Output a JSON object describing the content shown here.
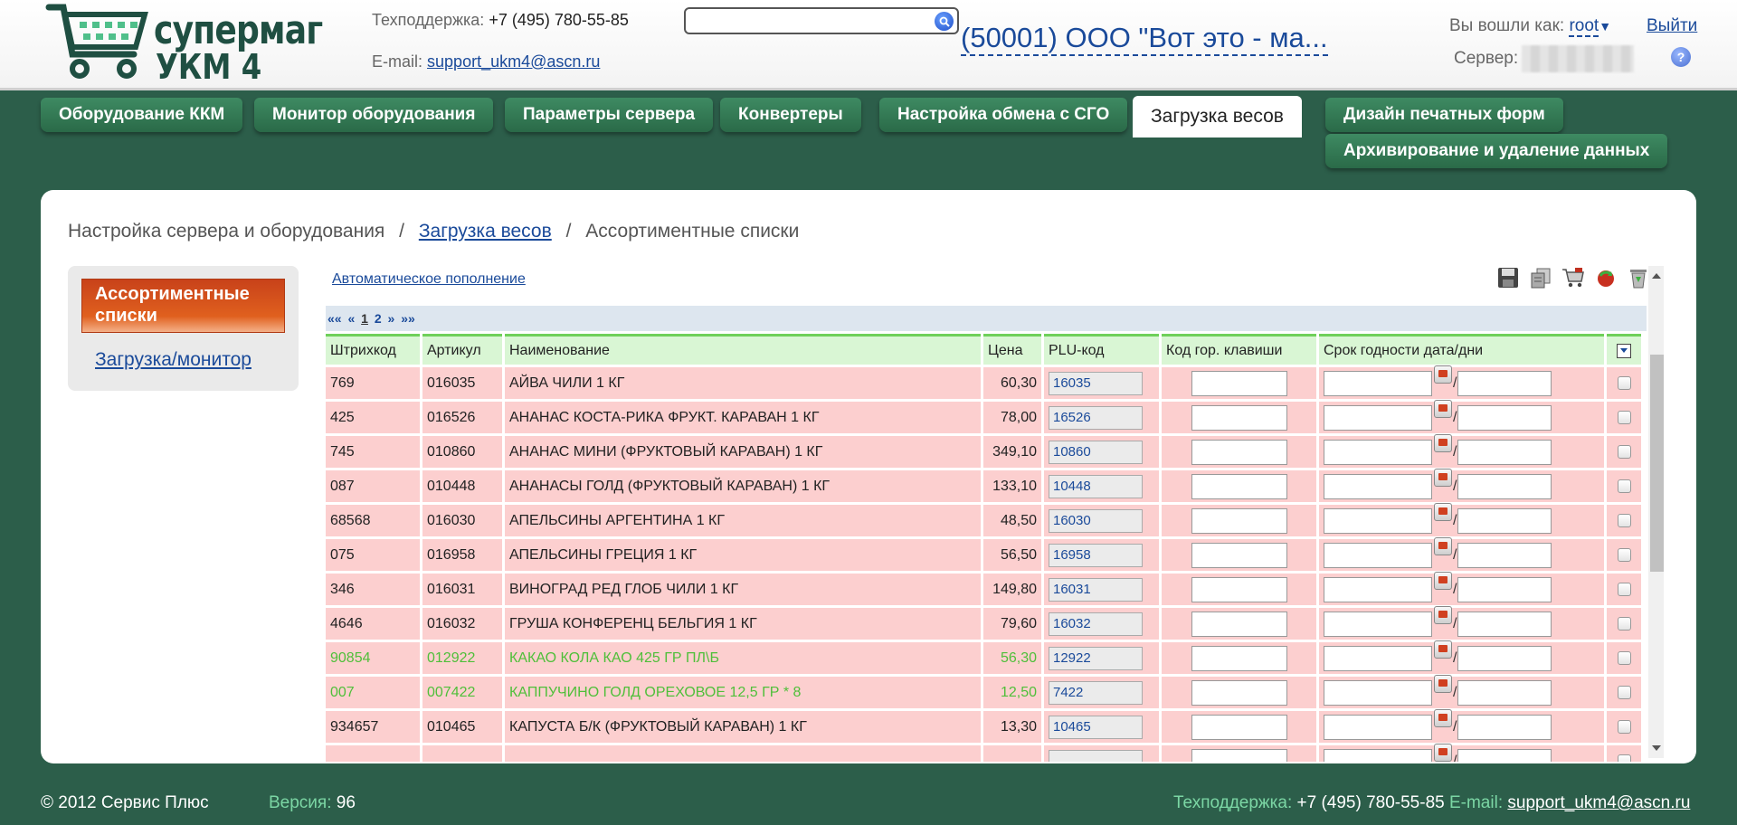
{
  "header": {
    "logo_line1": "супермаг",
    "logo_line2": "УКМ 4",
    "support_phone_label": "Техподдержка:",
    "support_phone": "+7 (495) 780-55-85",
    "email_label": "E-mail:",
    "email": "support_ukm4@ascn.ru",
    "search_value": "",
    "org_name": "(50001) ООО \"Вот это - ма...",
    "login_label": "Вы вошли как:",
    "login_user": "root",
    "logout": "Выйти",
    "server_label": "Сервер:"
  },
  "tabs": [
    {
      "label": "Оборудование ККМ"
    },
    {
      "label": "Монитор оборудования"
    },
    {
      "label": "Параметры сервера"
    },
    {
      "label": "Конвертеры"
    },
    {
      "label": "Настройка обмена с СГО"
    },
    {
      "label": "Загрузка весов"
    },
    {
      "label": "Дизайн печатных форм"
    },
    {
      "label": "Архивирование и удаление данных"
    }
  ],
  "active_tab": "Загрузка весов",
  "breadcrumb": {
    "root": "Настройка сервера и оборудования",
    "section": "Загрузка весов",
    "current": "Ассортиментные списки"
  },
  "sidebar": {
    "active": "Ассортиментные списки",
    "link": "Загрузка/монитор"
  },
  "content": {
    "auto_fill": "Автоматическое пополнение",
    "pager": {
      "first": "««",
      "prev": "«",
      "pages": [
        "1",
        "2"
      ],
      "current": "1",
      "next": "»",
      "last": "»»"
    },
    "columns": [
      "Штрихкод",
      "Артикул",
      "Наименование",
      "Цена",
      "PLU-код",
      "Код гор. клавиши",
      "Срок годности дата/дни"
    ],
    "rows": [
      {
        "barcode": "769",
        "article": "016035",
        "name": "АЙВА ЧИЛИ 1 КГ",
        "price": "60,30",
        "plu": "16035",
        "green": false
      },
      {
        "barcode": "425",
        "article": "016526",
        "name": "АНАНАС КОСТА-РИКА ФРУКТ. КАРАВАН 1 КГ",
        "price": "78,00",
        "plu": "16526",
        "green": false
      },
      {
        "barcode": "745",
        "article": "010860",
        "name": "АНАНАС МИНИ (ФРУКТОВЫЙ КАРАВАН) 1 КГ",
        "price": "349,10",
        "plu": "10860",
        "green": false
      },
      {
        "barcode": "087",
        "article": "010448",
        "name": "АНАНАСЫ ГОЛД (ФРУКТОВЫЙ КАРАВАН) 1 КГ",
        "price": "133,10",
        "plu": "10448",
        "green": false
      },
      {
        "barcode": "68568",
        "article": "016030",
        "name": "АПЕЛЬСИНЫ АРГЕНТИНА 1 КГ",
        "price": "48,50",
        "plu": "16030",
        "green": false
      },
      {
        "barcode": "075",
        "article": "016958",
        "name": "АПЕЛЬСИНЫ ГРЕЦИЯ 1 КГ",
        "price": "56,50",
        "plu": "16958",
        "green": false
      },
      {
        "barcode": "346",
        "article": "016031",
        "name": "ВИНОГРАД РЕД ГЛОБ ЧИЛИ 1 КГ",
        "price": "149,80",
        "plu": "16031",
        "green": false
      },
      {
        "barcode": "4646",
        "article": "016032",
        "name": "ГРУША КОНФЕРЕНЦ БЕЛЬГИЯ 1 КГ",
        "price": "79,60",
        "plu": "16032",
        "green": false
      },
      {
        "barcode": "90854",
        "article": "012922",
        "name": "КАКАО КОЛА КАО 425 ГР ПЛ\\Б",
        "price": "56,30",
        "plu": "12922",
        "green": true
      },
      {
        "barcode": "007",
        "article": "007422",
        "name": "КАППУЧИНО ГОЛД ОРЕХОВОЕ 12,5 ГР * 8",
        "price": "12,50",
        "plu": "7422",
        "green": true
      },
      {
        "barcode": "934657",
        "article": "010465",
        "name": "КАПУСТА Б/К (ФРУКТОВЫЙ КАРАВАН) 1 КГ",
        "price": "13,30",
        "plu": "10465",
        "green": false
      },
      {
        "barcode": "",
        "article": "",
        "name": "",
        "price": "",
        "plu": "",
        "green": false
      }
    ]
  },
  "footer": {
    "copyright": "© 2012 Сервис Плюс",
    "version_label": "Версия:",
    "version": "96",
    "support_label": "Техподдержка:",
    "support_phone": "+7 (495) 780-55-85",
    "email_label": "E-mail:",
    "email": "support_ukm4@ascn.ru"
  },
  "icons": [
    "save-icon",
    "copy-icon",
    "cart-icon",
    "refresh-icon",
    "trash-icon",
    "search-icon",
    "help-icon",
    "calendar-icon"
  ],
  "colors": {
    "background": "#2c5e4a",
    "tab": "#2f7250",
    "row": "#fccfcf",
    "header_row": "#d9f6d4",
    "link": "#1a4a9a",
    "active_item": "#d64c1c",
    "green_text": "#4fbf3a"
  }
}
